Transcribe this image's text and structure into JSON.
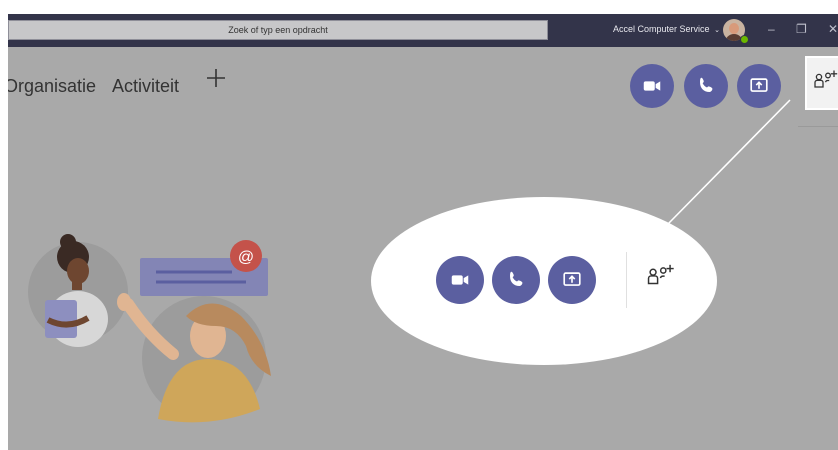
{
  "titlebar": {
    "search_placeholder": "Zoek of typ een opdracht",
    "account_label": "Accel Computer Service",
    "minimize_glyph": "–",
    "restore_glyph": "❐",
    "close_glyph": "✕"
  },
  "tabs": {
    "organisatie": "Organisatie",
    "activiteit": "Activiteit"
  },
  "icons": {
    "video": "video-call-icon",
    "phone": "audio-call-icon",
    "share": "share-screen-icon",
    "people": "add-people-icon"
  },
  "colors": {
    "titlebar": "#33344a",
    "button": "#5b5fa0",
    "overlay": "#a9a9a9",
    "accent_mention": "#c4524a",
    "presence": "#6bb700"
  }
}
